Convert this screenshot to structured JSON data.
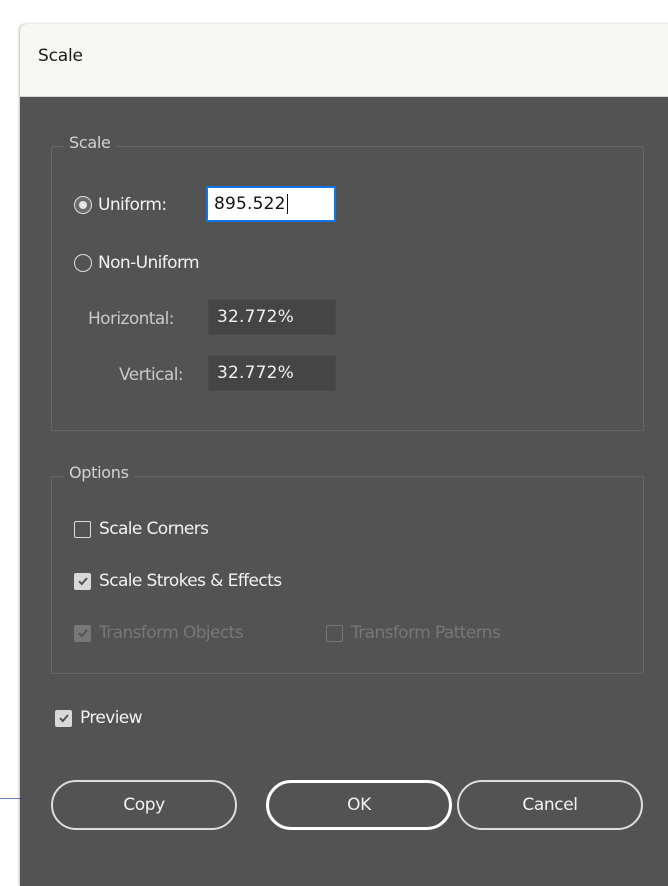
{
  "dialog": {
    "title": "Scale"
  },
  "scale_group": {
    "legend": "Scale",
    "uniform": {
      "label": "Uniform:",
      "value": "895.522",
      "selected": true
    },
    "non_uniform": {
      "label": "Non-Uniform",
      "selected": false
    },
    "horizontal": {
      "label": "Horizontal:",
      "value": "32.772%"
    },
    "vertical": {
      "label": "Vertical:",
      "value": "32.772%"
    }
  },
  "options_group": {
    "legend": "Options",
    "scale_corners": {
      "label": "Scale Corners",
      "checked": false
    },
    "scale_strokes": {
      "label": "Scale Strokes & Effects",
      "checked": true
    },
    "transform_objects": {
      "label": "Transform Objects",
      "checked": true,
      "enabled": false
    },
    "transform_patterns": {
      "label": "Transform Patterns",
      "checked": false,
      "enabled": false
    }
  },
  "preview": {
    "label": "Preview",
    "checked": true
  },
  "buttons": {
    "copy": "Copy",
    "ok": "OK",
    "cancel": "Cancel"
  },
  "colors": {
    "dialog_bg": "#535353",
    "titlebar_bg": "#f7f7f3",
    "focus_accent": "#1473e6"
  }
}
